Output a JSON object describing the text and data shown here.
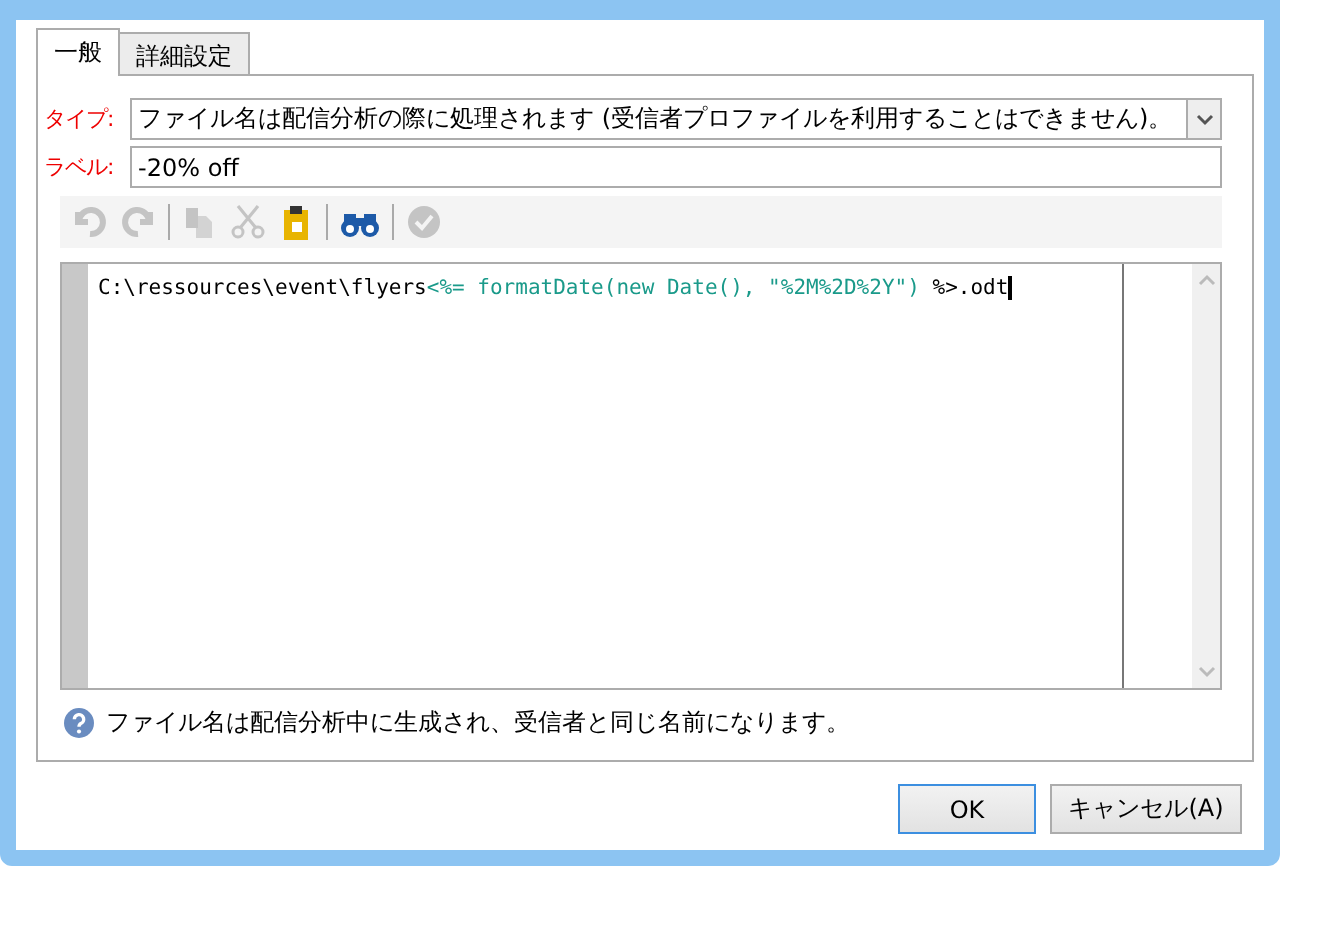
{
  "tabs": [
    {
      "label": "一般",
      "selected": true
    },
    {
      "label": "詳細設定",
      "selected": false
    }
  ],
  "type_field": {
    "label": "タイプ:",
    "value": "ファイル名は配信分析の際に処理されます (受信者プロファイルを利用することはできません)。"
  },
  "label_field": {
    "label": "ラベル:",
    "value": "-20% off"
  },
  "toolbar": [
    {
      "kind": "undo",
      "disabled": true
    },
    {
      "kind": "redo",
      "disabled": true
    },
    {
      "kind": "separator"
    },
    {
      "kind": "copy",
      "disabled": true
    },
    {
      "kind": "cut",
      "disabled": true
    },
    {
      "kind": "paste",
      "disabled": false
    },
    {
      "kind": "separator"
    },
    {
      "kind": "find",
      "disabled": false
    },
    {
      "kind": "separator"
    },
    {
      "kind": "check",
      "disabled": true
    }
  ],
  "editor": {
    "segments": [
      {
        "kind": "plain",
        "text": "C:\\ressources\\event\\flyers"
      },
      {
        "kind": "template",
        "text": "<%= formatDate(new Date(), \"%2M%2D%2Y\") "
      },
      {
        "kind": "plain",
        "text": "%>.odt"
      }
    ]
  },
  "help": "ファイル名は配信分析中に生成され、受信者と同じ名前になります。",
  "buttons": [
    {
      "label": "OK",
      "default": true
    },
    {
      "label": "キャンセル(A)",
      "default": false
    }
  ]
}
